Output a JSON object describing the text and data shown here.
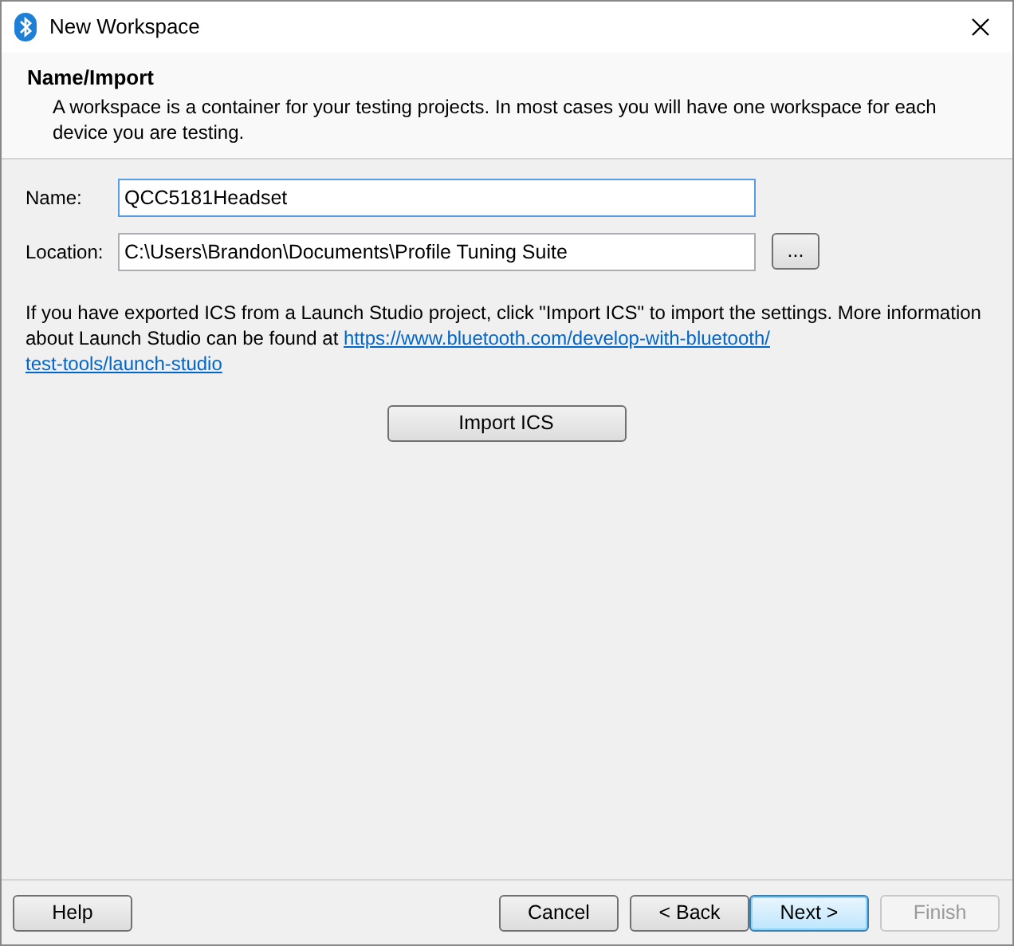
{
  "window": {
    "title": "New Workspace"
  },
  "header": {
    "title": "Name/Import",
    "description": "A workspace is a container for your testing projects. In most cases you will have one workspace for each device you are testing."
  },
  "fields": [
    {
      "label": "Name:",
      "value": "QCC5181Headset",
      "focused": true
    },
    {
      "label": "Location:",
      "value": "C:\\Users\\Brandon\\Documents\\Profile Tuning Suite",
      "focused": false,
      "browse": "..."
    }
  ],
  "info": {
    "text": "If you have exported ICS from a Launch Studio project, click \"Import ICS\" to import the settings. More information about Launch Studio can be found at",
    "link_lines": [
      "https://www.bluetooth.com/develop-with-bluetooth/",
      "test-tools/launch-studio"
    ]
  },
  "import_button": "Import ICS",
  "left_buttons": [
    {
      "label": "Help",
      "default": false,
      "disabled": false
    }
  ],
  "right_buttons": [
    {
      "label": "Cancel",
      "default": false,
      "disabled": false
    },
    {
      "label": "< Back",
      "default": false,
      "disabled": false
    },
    {
      "label": "Next >",
      "default": true,
      "disabled": false
    },
    {
      "label": "Finish",
      "default": false,
      "disabled": true
    }
  ]
}
